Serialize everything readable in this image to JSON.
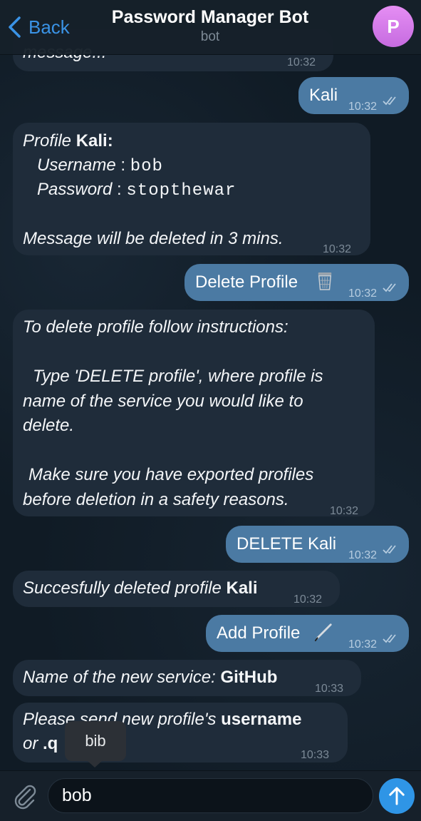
{
  "header": {
    "back_label": "Back",
    "title": "Password Manager Bot",
    "subtitle": "bot",
    "avatar_letter": "P"
  },
  "messages": {
    "m0": {
      "text": "message...",
      "time": "10:32"
    },
    "m1": {
      "text": "Kali",
      "time": "10:32"
    },
    "m2": {
      "prefix": "Profile ",
      "profile_name": "Kali:",
      "username_label": "Username",
      "username_sep": " : ",
      "username_value": "bob",
      "password_label": "Password",
      "password_sep": " : ",
      "password_value": "stopthewar",
      "footer": "Message will be deleted in 3 mins.",
      "time": "10:32"
    },
    "m3": {
      "text": "Delete Profile",
      "emoji": "wastebasket",
      "time": "10:32"
    },
    "m4": {
      "line1": "To delete profile follow instructions:",
      "line2": "Type 'DELETE profile', where profile is",
      "line3": "name of the service you would like to",
      "line4": "delete.",
      "line5": "Make sure you have exported profiles",
      "line6": "before deletion in a safety reasons.",
      "time": "10:32"
    },
    "m5": {
      "text": "DELETE Kali",
      "time": "10:32"
    },
    "m6": {
      "prefix": "Succesfully deleted profile ",
      "name": "Kali",
      "time": "10:32"
    },
    "m7": {
      "text": "Add Profile",
      "emoji": "pen",
      "time": "10:32"
    },
    "m8": {
      "prefix": "Name of the new service: ",
      "name": "GitHub",
      "time": "10:33"
    },
    "m9": {
      "line1_prefix": "Please send new profile's ",
      "line1_bold": "username",
      "line2_prefix": "or ",
      "line2_bold": ".q",
      "time": "10:33"
    }
  },
  "tooltip": {
    "text": "bib"
  },
  "composer": {
    "value": "bob"
  },
  "colors": {
    "accent": "#3a93e6",
    "outgoing_bubble": "#4b7aa3",
    "incoming_bubble": "#1f2c3a",
    "send_button": "#2f95e6",
    "avatar": "#d47ce9"
  }
}
